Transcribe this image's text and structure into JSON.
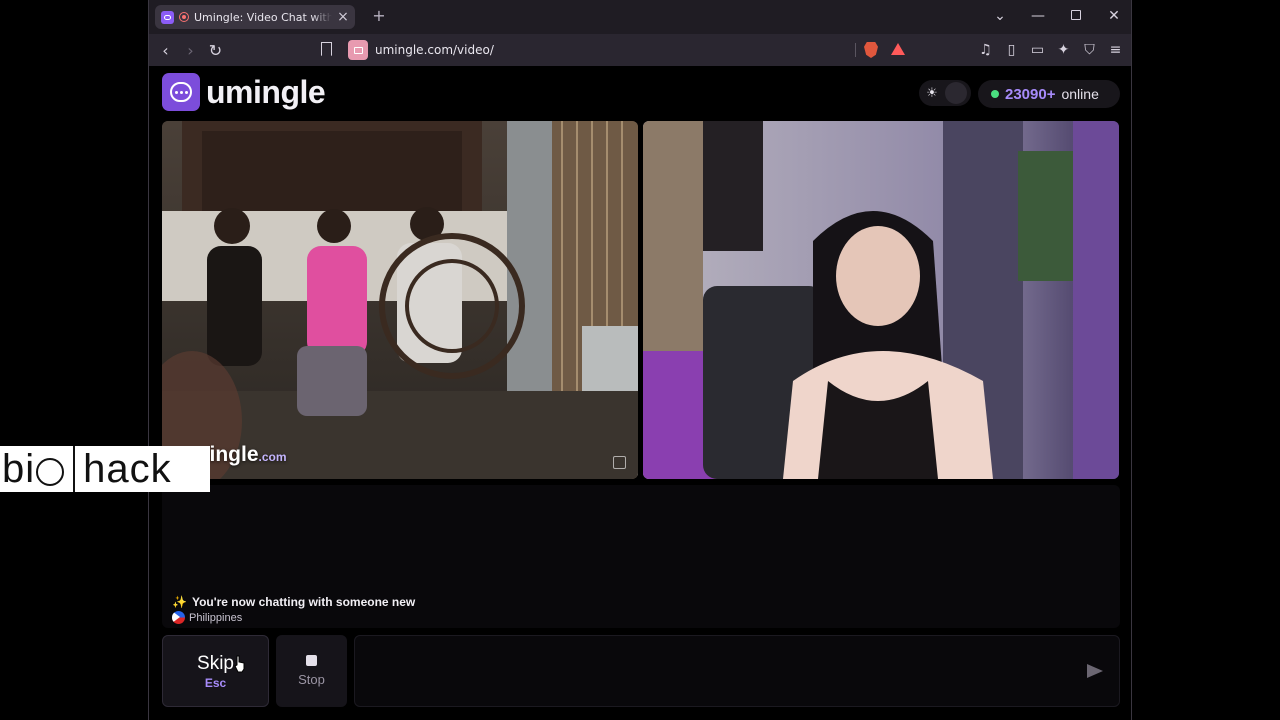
{
  "browser": {
    "tab_title": "Umingle: Video Chat with Strangers",
    "tab_close": "×",
    "new_tab": "+",
    "url": "umingle.com/video/",
    "window_controls": {
      "tabs_menu": "⌄",
      "minimize": "—",
      "close": "✕"
    },
    "toolbar_icons": {
      "back": "‹",
      "forward": "›",
      "reload": "↻",
      "music": "♫",
      "sidebar": "▯",
      "wallet": "▭",
      "leo": "✦",
      "vpn": "⛉",
      "menu": "≡"
    }
  },
  "header": {
    "logo_text": "umingle",
    "theme_icon": "☀",
    "online_count": "23090+",
    "online_label": "online"
  },
  "video": {
    "watermark": "umingle",
    "watermark_suffix": ".com"
  },
  "chat": {
    "system_icon": "✨",
    "system_message": "You're now chatting with someone new",
    "country": "Philippines"
  },
  "controls": {
    "skip_label": "Skip",
    "skip_key": "Esc",
    "stop_label": "Stop",
    "message_placeholder": ""
  },
  "overlay": {
    "brand_left": "bi",
    "brand_right": "hack"
  },
  "colors": {
    "accent": "#7c4ddb",
    "online_count": "#a78bfa",
    "online_dot": "#4ade80"
  }
}
